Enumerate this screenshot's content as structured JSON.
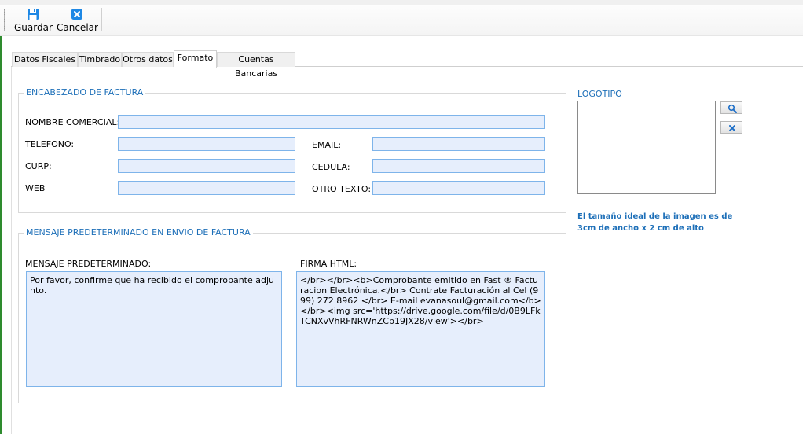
{
  "toolbar": {
    "save_label": "Guardar",
    "cancel_label": "Cancelar"
  },
  "tabs": [
    {
      "label": "Datos Fiscales"
    },
    {
      "label": "Timbrado"
    },
    {
      "label": "Otros datos"
    },
    {
      "label": "Formato"
    },
    {
      "label": "Cuentas Bancarias"
    }
  ],
  "active_tab": "Formato",
  "encabezado": {
    "legend": "ENCABEZADO DE FACTURA",
    "nombre_comercial": {
      "label": "NOMBRE COMERCIAL:",
      "value": ""
    },
    "telefono": {
      "label": "TELEFONO:",
      "value": ""
    },
    "email": {
      "label": "EMAIL:",
      "value": ""
    },
    "curp": {
      "label": "CURP:",
      "value": ""
    },
    "cedula": {
      "label": "CEDULA:",
      "value": ""
    },
    "web": {
      "label": "WEB",
      "value": ""
    },
    "otro_texto": {
      "label": "OTRO TEXTO:",
      "value": ""
    }
  },
  "mensaje": {
    "legend": "MENSAJE PREDETERMINADO EN ENVIO DE FACTURA",
    "predeterminado_label": "MENSAJE PREDETERMINADO:",
    "predeterminado_value": "Por favor, confirme que ha recibido el comprobante adjunto.",
    "firma_label": "FIRMA HTML:",
    "firma_value": "</br></br><b>Comprobante emitido en Fast ® Facturacion Electrónica.</br> Contrate Facturación al Cel (999) 272 8962 </br> E-mail evanasoul@gmail.com</b> </br><img src='https://drive.google.com/file/d/0B9LFkTCNXvVhRFNRWnZCb19JX28/view'></br>"
  },
  "logotipo": {
    "label": "LOGOTIPO",
    "note": "El tamaño ideal de la imagen es de 3cm de ancho x 2 cm de alto"
  },
  "colors": {
    "accent": "#1d6fb8",
    "field_bg": "#e6eefc",
    "field_border": "#7eb4ea",
    "toolbar_icon": "#1e88e5"
  }
}
